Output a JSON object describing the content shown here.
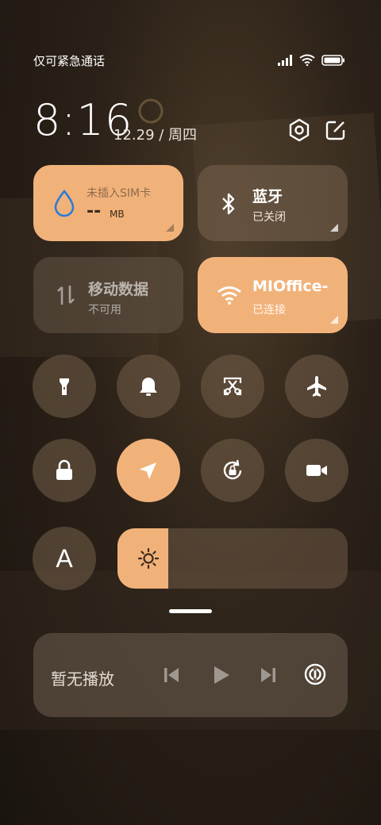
{
  "status_bar": {
    "carrier_text": "仅可紧急通话",
    "icons": [
      "signal-icon",
      "wifi-icon",
      "battery-icon"
    ]
  },
  "header": {
    "time": "8:16",
    "date": "12.29 / 周四",
    "icons": [
      "settings-icon",
      "edit-icon"
    ]
  },
  "tiles": {
    "data_usage": {
      "title": "未插入SIM卡",
      "value": "--",
      "unit": "MB",
      "state": "on"
    },
    "bluetooth": {
      "title": "蓝牙",
      "status": "已关闭",
      "state": "off"
    },
    "mobile_data": {
      "title": "移动数据",
      "status": "不可用",
      "state": "disabled"
    },
    "wifi": {
      "title": "MIOffice-",
      "status": "已连接",
      "state": "on"
    }
  },
  "toggles": [
    {
      "name": "flashlight",
      "icon": "flashlight-icon",
      "active": false
    },
    {
      "name": "ringer",
      "icon": "bell-icon",
      "active": false
    },
    {
      "name": "screenshot",
      "icon": "scissors-icon",
      "active": false
    },
    {
      "name": "airplane",
      "icon": "airplane-icon",
      "active": false
    },
    {
      "name": "lock-screen",
      "icon": "lock-icon",
      "active": false
    },
    {
      "name": "location",
      "icon": "location-arrow-icon",
      "active": true
    },
    {
      "name": "rotation-lock",
      "icon": "rotation-lock-icon",
      "active": false
    },
    {
      "name": "screen-record",
      "icon": "video-camera-icon",
      "active": false
    },
    {
      "name": "auto-brightness",
      "icon": "letter-a-icon",
      "active": false,
      "glyph": "A"
    }
  ],
  "brightness": {
    "level": 0.22,
    "icon": "sun-icon"
  },
  "media": {
    "label": "暂无播放",
    "icons": [
      "previous-icon",
      "play-icon",
      "next-icon",
      "cast-icon"
    ]
  },
  "colors": {
    "accent": "#f1b27a",
    "tile_off": "#7a6450"
  }
}
